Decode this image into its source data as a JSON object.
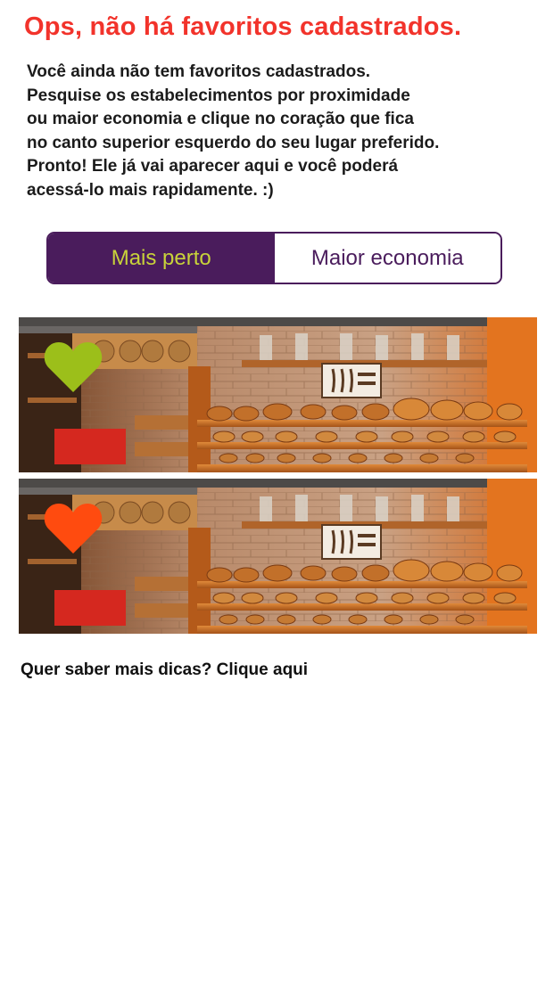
{
  "empty_state": {
    "title": "Ops, não há favoritos cadastrados.",
    "description_lines": [
      "Você ainda não tem favoritos cadastrados.",
      "Pesquise os estabelecimentos por proximidade",
      "ou maior economia e clique no coração que fica",
      "no canto superior esquerdo do seu lugar preferido.",
      "Pronto! Ele já vai aparecer aqui e você poderá",
      "acessá-lo mais rapidamente. :)"
    ]
  },
  "tabs": {
    "nearest_label": "Mais perto",
    "economy_label": "Maior economia",
    "selected": "Mais perto"
  },
  "examples": [
    {
      "image": "bakery-shelves-photo",
      "heart_icon": "heart-icon",
      "heart_color": "#9cbf1a"
    },
    {
      "image": "bakery-shelves-photo",
      "heart_icon": "heart-icon",
      "heart_color": "#ff4b0f"
    }
  ],
  "footer": {
    "tips_link": "Quer saber mais dicas? Clique aqui"
  },
  "colors": {
    "title": "#f2332b",
    "brand_purple": "#4a1c5c",
    "active_tab_text": "#c8d23a"
  }
}
